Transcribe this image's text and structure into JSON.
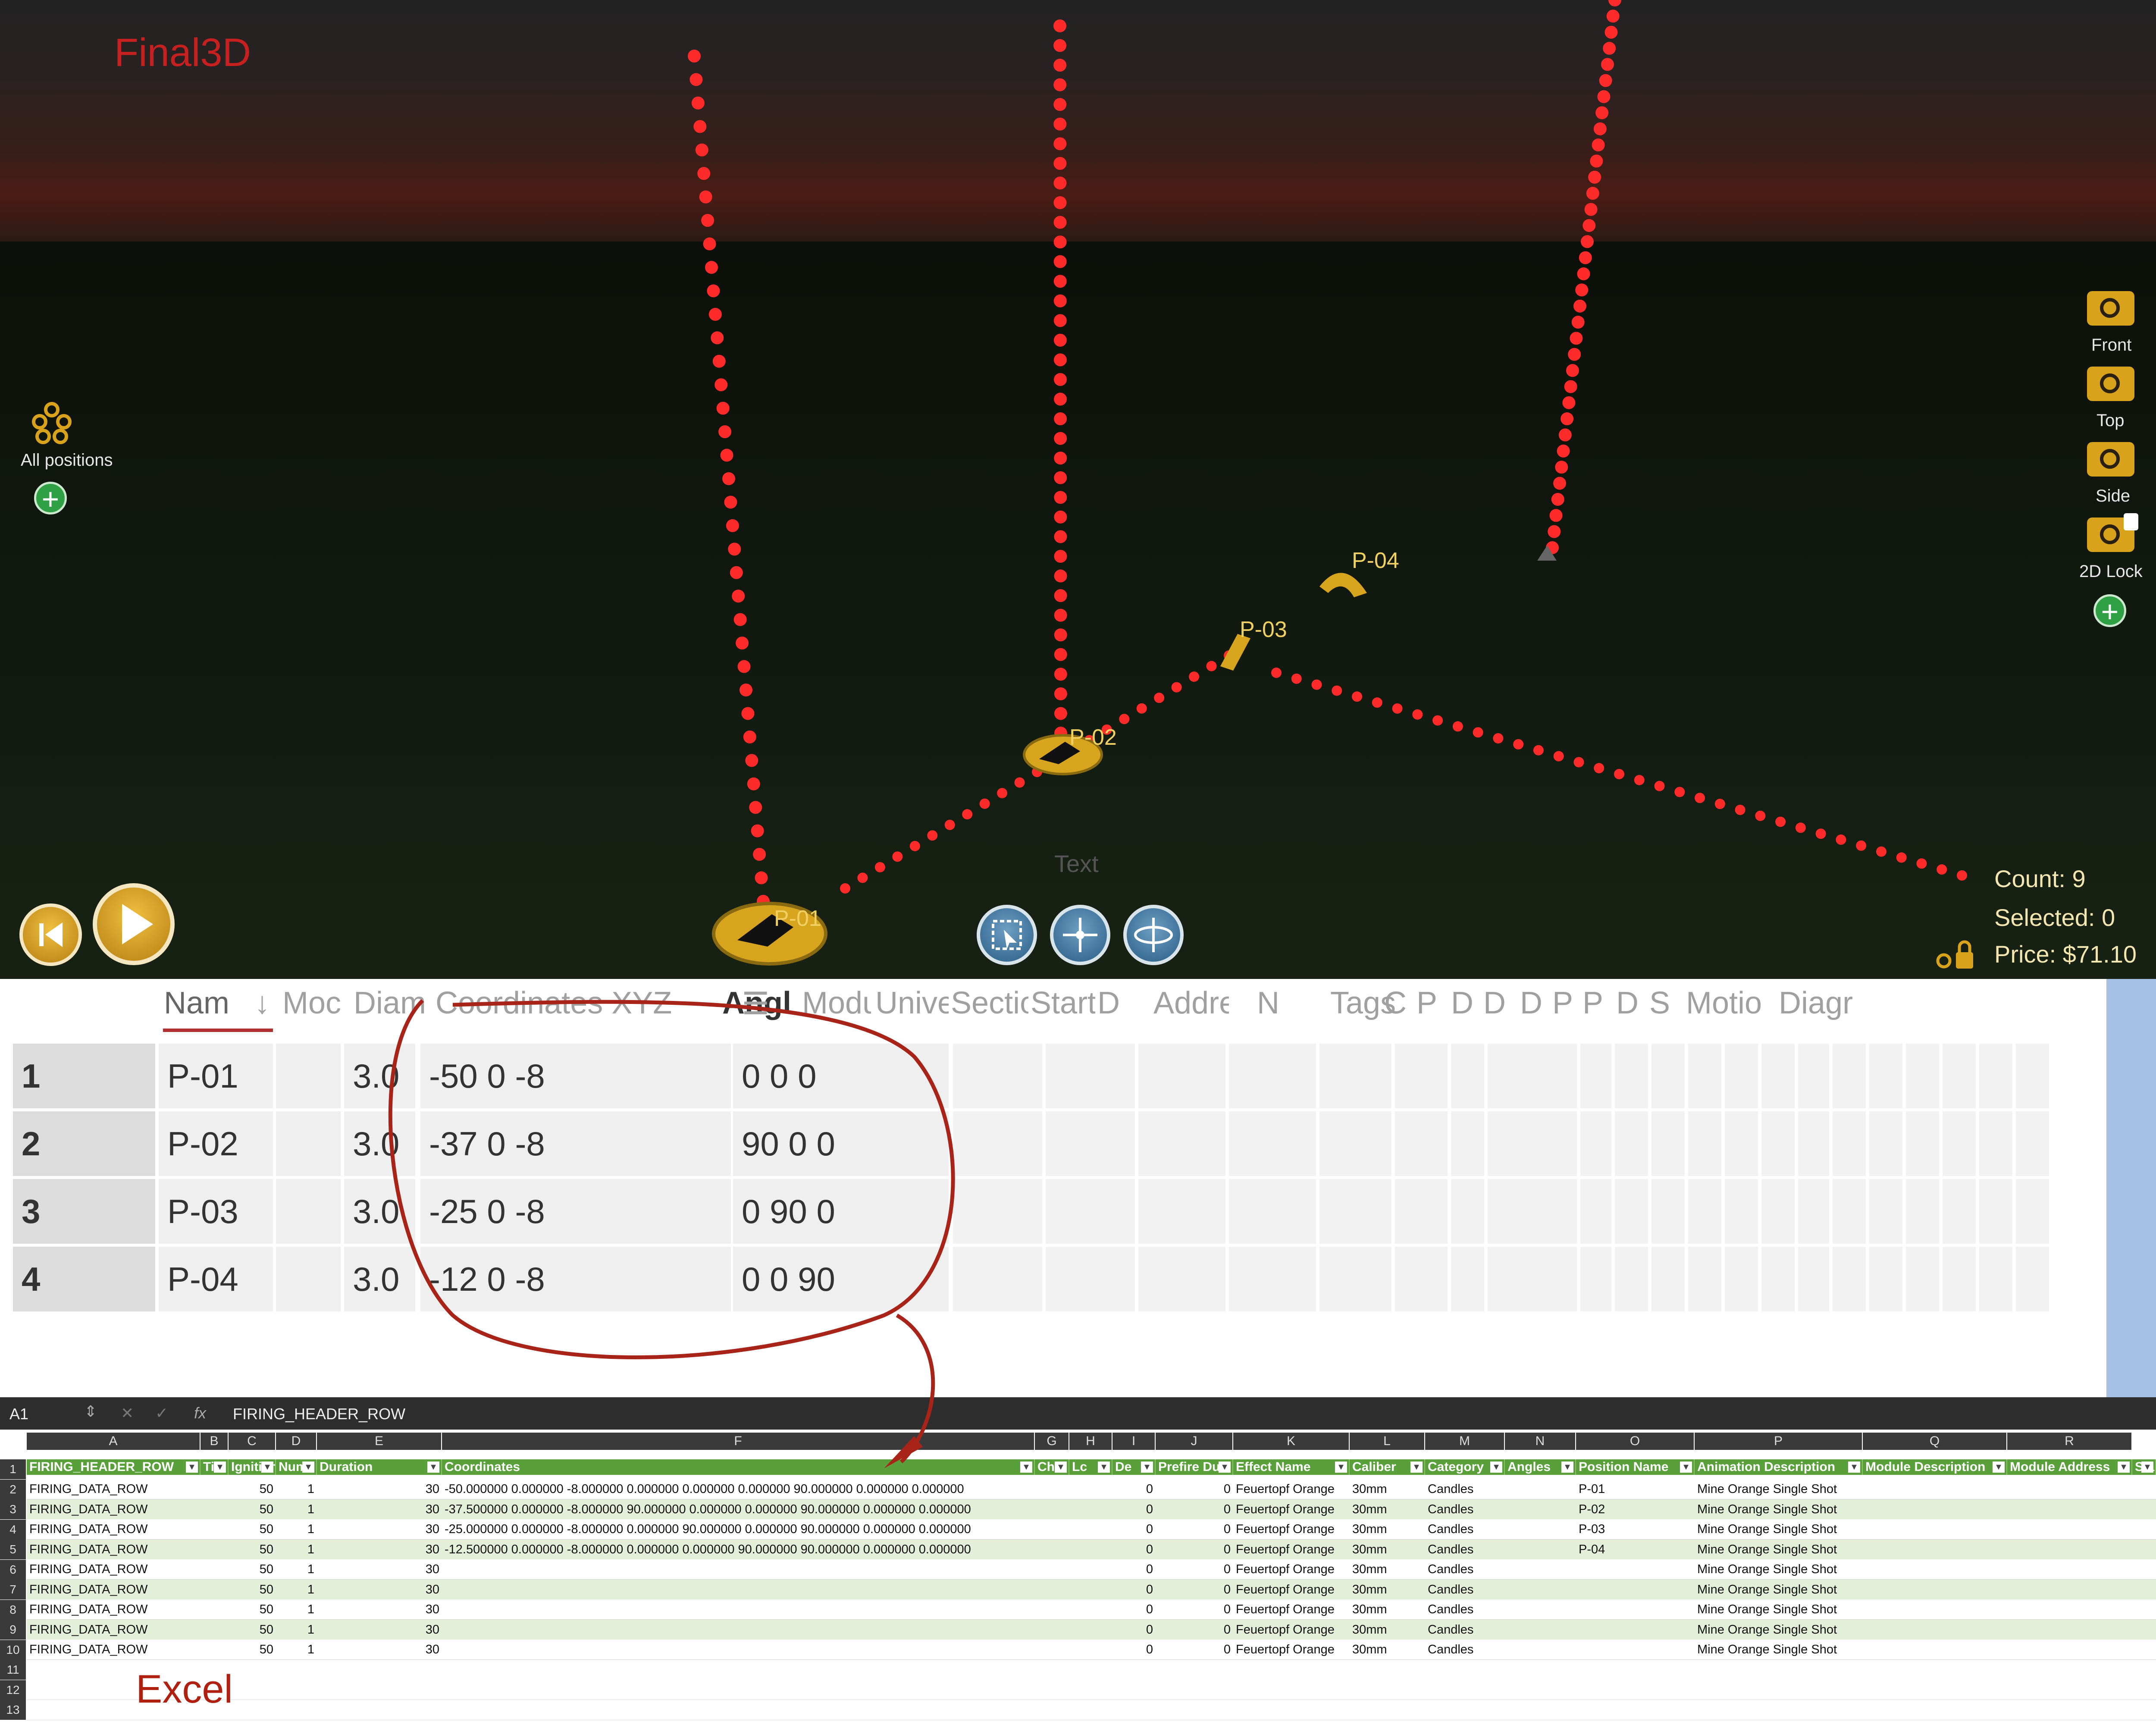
{
  "viewport": {
    "brand": "Final3D",
    "all_positions_label": "All positions",
    "camera_labels": [
      "Front",
      "Top",
      "Side",
      "2D Lock"
    ],
    "positions": [
      "P-01",
      "P-02",
      "P-03",
      "P-04"
    ],
    "overlay_text": "Text",
    "count": "Count: 9",
    "selected": "Selected: 0",
    "price": "Price: $71.10"
  },
  "grid": {
    "headers": [
      "Nam",
      "↓",
      "Moc",
      "Diam",
      "Coordinates XYZ",
      "Angle HPR",
      "☰",
      "Modu",
      "Unive",
      "Sectio",
      "Start",
      "D",
      "Addre",
      "N",
      "Tags",
      "C",
      "P",
      "D",
      "D",
      "D",
      "P",
      "P",
      "D",
      "S",
      "Motio",
      "Diagr"
    ],
    "rows": [
      {
        "num": "1",
        "name": "P-01",
        "diam": "3.0",
        "coords": "-50 0 -8",
        "angle": "0 0 0"
      },
      {
        "num": "2",
        "name": "P-02",
        "diam": "3.0",
        "coords": "-37 0 -8",
        "angle": "90 0 0"
      },
      {
        "num": "3",
        "name": "P-03",
        "diam": "3.0",
        "coords": "-25 0 -8",
        "angle": "0 90 0"
      },
      {
        "num": "4",
        "name": "P-04",
        "diam": "3.0",
        "coords": "-12 0 -8",
        "angle": "0 0 90"
      }
    ]
  },
  "excel": {
    "name_box": "A1",
    "fx": "fx",
    "formula": "FIRING_HEADER_ROW",
    "col_letters": [
      "A",
      "B",
      "C",
      "D",
      "E",
      "F",
      "G",
      "H",
      "I",
      "J",
      "K",
      "L",
      "M",
      "N",
      "O",
      "P",
      "Q",
      "R"
    ],
    "headers": [
      "FIRING_HEADER_ROW",
      "Tim",
      "Ignition",
      "Num",
      "Duration",
      "Coordinates",
      "Cha",
      "Lc",
      "De",
      "Prefire Du",
      "Effect Name",
      "Caliber",
      "Category",
      "Angles",
      "Position Name",
      "Animation Description",
      "Module Description",
      "Module Address",
      "Sla"
    ],
    "row_numbers": [
      "1",
      "2",
      "3",
      "4",
      "5",
      "6",
      "7",
      "8",
      "9",
      "10",
      "11",
      "12",
      "13"
    ],
    "rows": [
      {
        "a": "FIRING_DATA_ROW",
        "c": "50",
        "d": "1",
        "e": "30",
        "f": "-50.000000 0.000000 -8.000000 0.000000 0.000000 0.000000 90.000000 0.000000 0.000000",
        "i": "0",
        "j": "0",
        "k": "Feuertopf Orange",
        "l": "30mm",
        "m": "Candles",
        "o": "P-01",
        "p": "Mine Orange Single Shot"
      },
      {
        "a": "FIRING_DATA_ROW",
        "c": "50",
        "d": "1",
        "e": "30",
        "f": "-37.500000 0.000000 -8.000000 90.000000 0.000000 0.000000 90.000000 0.000000 0.000000",
        "i": "0",
        "j": "0",
        "k": "Feuertopf Orange",
        "l": "30mm",
        "m": "Candles",
        "o": "P-02",
        "p": "Mine Orange Single Shot"
      },
      {
        "a": "FIRING_DATA_ROW",
        "c": "50",
        "d": "1",
        "e": "30",
        "f": "-25.000000 0.000000 -8.000000 0.000000 90.000000 0.000000 90.000000 0.000000 0.000000",
        "i": "0",
        "j": "0",
        "k": "Feuertopf Orange",
        "l": "30mm",
        "m": "Candles",
        "o": "P-03",
        "p": "Mine Orange Single Shot"
      },
      {
        "a": "FIRING_DATA_ROW",
        "c": "50",
        "d": "1",
        "e": "30",
        "f": "-12.500000 0.000000 -8.000000 0.000000 0.000000 90.000000 90.000000 0.000000 0.000000",
        "i": "0",
        "j": "0",
        "k": "Feuertopf Orange",
        "l": "30mm",
        "m": "Candles",
        "o": "P-04",
        "p": "Mine Orange Single Shot"
      },
      {
        "a": "FIRING_DATA_ROW",
        "c": "50",
        "d": "1",
        "e": "30",
        "f": "",
        "i": "0",
        "j": "0",
        "k": "Feuertopf Orange",
        "l": "30mm",
        "m": "Candles",
        "o": "",
        "p": "Mine Orange Single Shot"
      },
      {
        "a": "FIRING_DATA_ROW",
        "c": "50",
        "d": "1",
        "e": "30",
        "f": "",
        "i": "0",
        "j": "0",
        "k": "Feuertopf Orange",
        "l": "30mm",
        "m": "Candles",
        "o": "",
        "p": "Mine Orange Single Shot"
      },
      {
        "a": "FIRING_DATA_ROW",
        "c": "50",
        "d": "1",
        "e": "30",
        "f": "",
        "i": "0",
        "j": "0",
        "k": "Feuertopf Orange",
        "l": "30mm",
        "m": "Candles",
        "o": "",
        "p": "Mine Orange Single Shot"
      },
      {
        "a": "FIRING_DATA_ROW",
        "c": "50",
        "d": "1",
        "e": "30",
        "f": "",
        "i": "0",
        "j": "0",
        "k": "Feuertopf Orange",
        "l": "30mm",
        "m": "Candles",
        "o": "",
        "p": "Mine Orange Single Shot"
      },
      {
        "a": "FIRING_DATA_ROW",
        "c": "50",
        "d": "1",
        "e": "30",
        "f": "",
        "i": "0",
        "j": "0",
        "k": "Feuertopf Orange",
        "l": "30mm",
        "m": "Candles",
        "o": "",
        "p": "Mine Orange Single Shot"
      }
    ],
    "annotation": "Excel"
  }
}
